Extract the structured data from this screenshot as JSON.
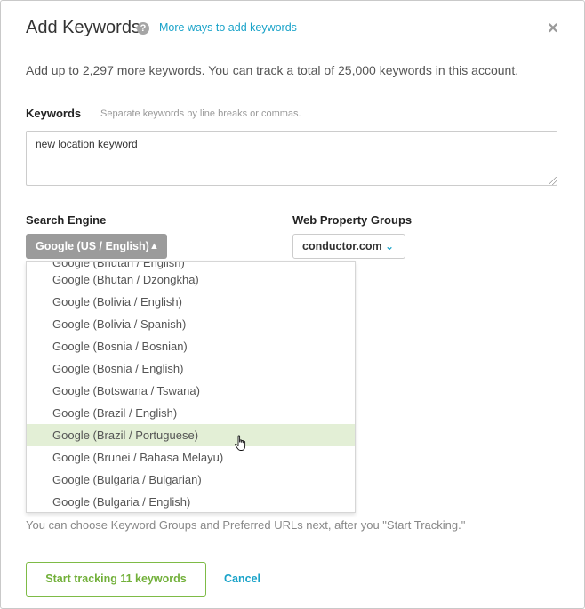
{
  "dialog": {
    "title": "Add Keywords",
    "help_icon": "?",
    "more_link": "More ways to add keywords",
    "close_icon": "×",
    "limit_text": "Add up to 2,297 more keywords. You can track a total of 25,000 keywords in this account."
  },
  "keywords": {
    "label": "Keywords",
    "hint": "Separate keywords by line breaks or commas.",
    "value": "new location keyword"
  },
  "search_engine": {
    "label": "Search Engine",
    "selected": "Google (US / English)",
    "chevron": "▲",
    "options": [
      "Google (Bhutan / English)",
      "Google (Bhutan / Dzongkha)",
      "Google (Bolivia / English)",
      "Google (Bolivia / Spanish)",
      "Google (Bosnia / Bosnian)",
      "Google (Bosnia / English)",
      "Google (Botswana / Tswana)",
      "Google (Brazil / English)",
      "Google (Brazil / Portuguese)",
      "Google (Brunei / Bahasa Melayu)",
      "Google (Bulgaria / Bulgarian)",
      "Google (Bulgaria / English)"
    ],
    "highlighted_index": 8
  },
  "web_property_groups": {
    "label": "Web Property Groups",
    "selected": "conductor.com",
    "chevron": "⌄"
  },
  "note": "You can choose Keyword Groups and Preferred URLs next, after you \"Start Tracking.\"",
  "footer": {
    "start_button": "Start tracking 11 keywords",
    "cancel_link": "Cancel"
  },
  "colors": {
    "accent_link": "#1aa3c9",
    "start_green": "#72b03a",
    "highlight_row": "#e3efd6",
    "select_gray": "#9b9b9b"
  }
}
